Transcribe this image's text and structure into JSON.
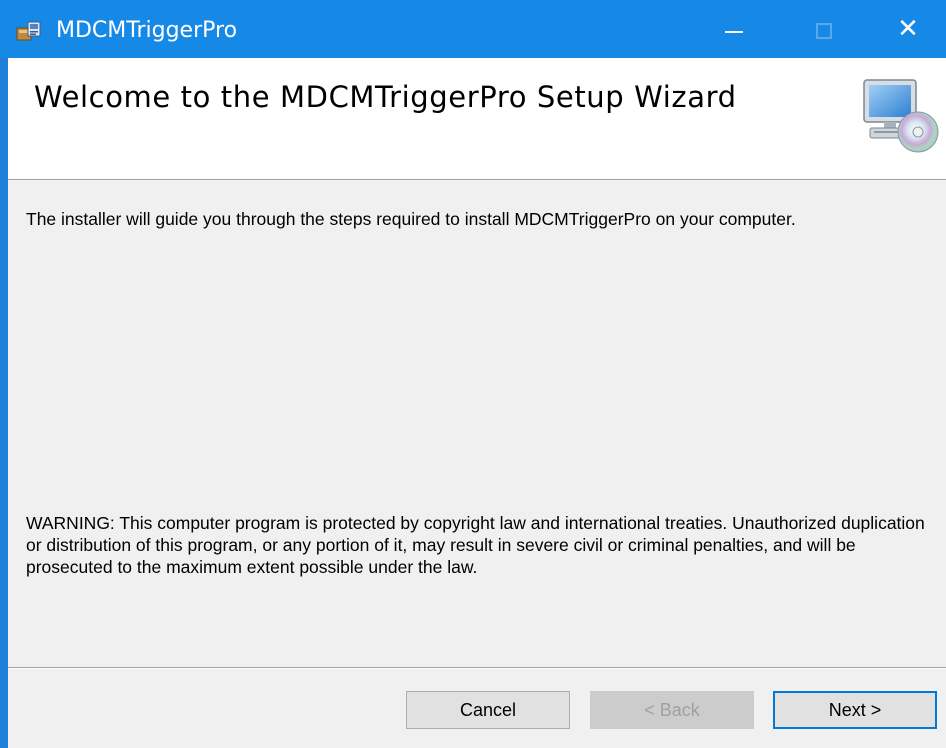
{
  "window": {
    "title": "MDCMTriggerPro",
    "controls": {
      "minimize": "minimize",
      "maximize": "maximize",
      "close": "close"
    }
  },
  "banner": {
    "title": "Welcome to the MDCMTriggerPro Setup Wizard",
    "icon": "computer-cd-icon"
  },
  "body": {
    "intro": "The installer will guide you through the steps required to install MDCMTriggerPro on your computer.",
    "warning": "WARNING: This computer program is protected by copyright law and international treaties. Unauthorized duplication or distribution of this program, or any portion of it, may result in severe civil or criminal penalties, and will be prosecuted to the maximum extent possible under the law."
  },
  "buttons": {
    "cancel": "Cancel",
    "back": "< Back",
    "next": "Next >"
  },
  "colors": {
    "titlebar": "#1689e7",
    "accent": "#0078d7",
    "background": "#f0f0f0"
  }
}
